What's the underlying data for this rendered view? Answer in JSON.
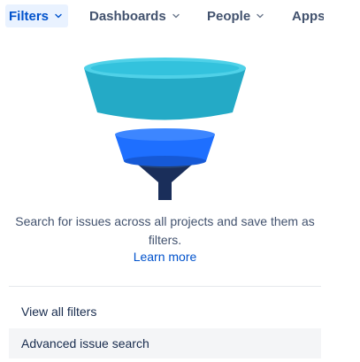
{
  "nav": {
    "items": [
      {
        "label": "Filters",
        "active": true
      },
      {
        "label": "Dashboards",
        "active": false
      },
      {
        "label": "People",
        "active": false
      },
      {
        "label": "Apps",
        "active": false
      }
    ]
  },
  "panel": {
    "empty_state": {
      "illustration": "funnel-illustration",
      "message": "Search for issues across all projects and save them as filters.",
      "link_label": "Learn more"
    },
    "menu": [
      {
        "label": "View all filters"
      },
      {
        "label": "Advanced issue search"
      }
    ]
  },
  "colors": {
    "accent": "#0052cc",
    "active_tab_bg": "#e9f2ff",
    "funnel_top": "#29b6d0",
    "funnel_mid": "#1e6fff",
    "funnel_bottom": "#1a2e5a"
  }
}
